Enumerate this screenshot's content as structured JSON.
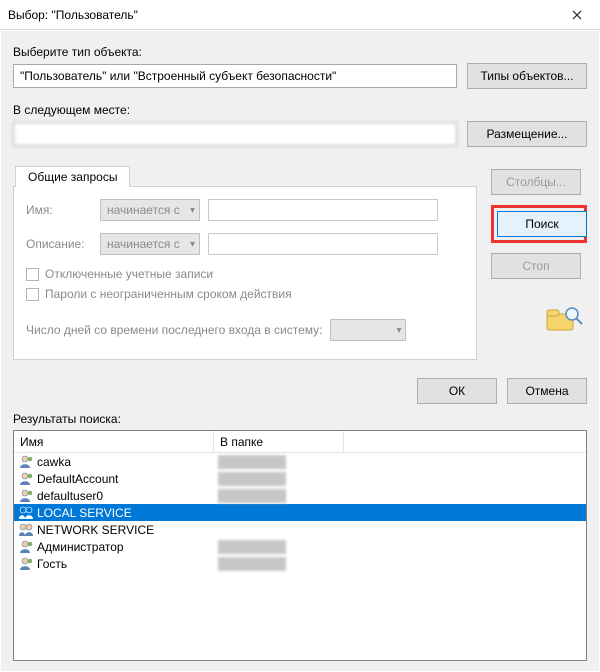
{
  "window": {
    "title": "Выбор: \"Пользователь\""
  },
  "sections": {
    "object_type_label": "Выберите тип объекта:",
    "object_type_value": "\"Пользователь\" или \"Встроенный субъект безопасности\"",
    "object_types_btn": "Типы объектов...",
    "location_label": "В следующем месте:",
    "location_value": "",
    "location_btn": "Размещение..."
  },
  "queries": {
    "tab_label": "Общие запросы",
    "name_label": "Имя:",
    "desc_label": "Описание:",
    "starts_with": "начинается с",
    "disabled_accounts": "Отключенные учетные записи",
    "no_password_expiry": "Пароли с неограниченным сроком действия",
    "days_label": "Число дней со времени последнего входа в систему:"
  },
  "side": {
    "columns": "Столбцы...",
    "search": "Поиск",
    "stop": "Стоп"
  },
  "footer": {
    "ok": "ОК",
    "cancel": "Отмена",
    "results_label": "Результаты поиска:"
  },
  "listview": {
    "col_name": "Имя",
    "col_folder": "В папке",
    "rows": [
      {
        "name": "cawka",
        "icon": "user-single",
        "redacted": true,
        "selected": false
      },
      {
        "name": "DefaultAccount",
        "icon": "user-single",
        "redacted": true,
        "selected": false
      },
      {
        "name": "defaultuser0",
        "icon": "user-single",
        "redacted": true,
        "selected": false
      },
      {
        "name": "LOCAL SERVICE",
        "icon": "user-group",
        "redacted": false,
        "selected": true
      },
      {
        "name": "NETWORK SERVICE",
        "icon": "user-group",
        "redacted": false,
        "selected": false
      },
      {
        "name": "Администратор",
        "icon": "user-single",
        "redacted": true,
        "selected": false
      },
      {
        "name": "Гость",
        "icon": "user-single",
        "redacted": true,
        "selected": false
      }
    ]
  }
}
